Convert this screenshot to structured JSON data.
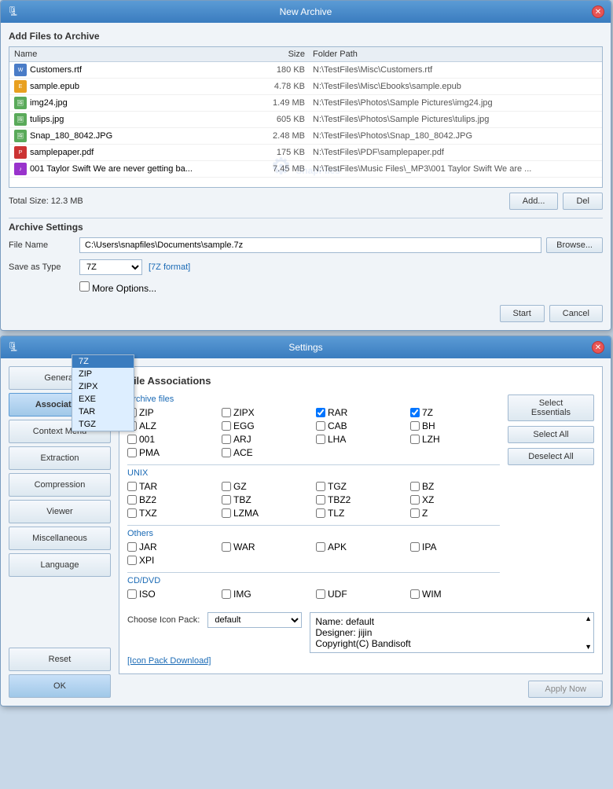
{
  "newArchive": {
    "title": "New Archive",
    "addFilesSection": "Add Files to Archive",
    "columns": {
      "name": "Name",
      "size": "Size",
      "folderPath": "Folder Path"
    },
    "files": [
      {
        "name": "Customers.rtf",
        "size": "180 KB",
        "path": "N:\\TestFiles\\Misc\\Customers.rtf",
        "type": "rtf"
      },
      {
        "name": "sample.epub",
        "size": "4.78 KB",
        "path": "N:\\TestFiles\\Misc\\Ebooks\\sample.epub",
        "type": "epub"
      },
      {
        "name": "img24.jpg",
        "size": "1.49 MB",
        "path": "N:\\TestFiles\\Photos\\Sample Pictures\\img24.jpg",
        "type": "img"
      },
      {
        "name": "tulips.jpg",
        "size": "605 KB",
        "path": "N:\\TestFiles\\Photos\\Sample Pictures\\tulips.jpg",
        "type": "img"
      },
      {
        "name": "Snap_180_8042.JPG",
        "size": "2.48 MB",
        "path": "N:\\TestFiles\\Photos\\Snap_180_8042.JPG",
        "type": "img"
      },
      {
        "name": "samplepaper.pdf",
        "size": "175 KB",
        "path": "N:\\TestFiles\\PDF\\samplepaper.pdf",
        "type": "pdf"
      },
      {
        "name": "001 Taylor Swift We are never getting ba...",
        "size": "7.45 MB",
        "path": "N:\\TestFiles\\Music Files\\_MP3\\001 Taylor Swift We are ...",
        "type": "mp3"
      }
    ],
    "watermark": "SnapFiles",
    "totalSize": "Total Size: 12.3 MB",
    "addButton": "Add...",
    "delButton": "Del",
    "archiveSettings": "Archive Settings",
    "fileName": "File Name",
    "fileNameValue": "C:\\Users\\snapfiles\\Documents\\sample.7z",
    "browseButton": "Browse...",
    "saveAsType": "Save as Type",
    "saveAsTypeValue": "7Z",
    "formatNote": "[7Z format]",
    "moreOptions": "More Options...",
    "startButton": "Start",
    "cancelButton": "Cancel",
    "dropdownOptions": [
      "ZIP",
      "ZIPX",
      "EXE",
      "TAR",
      "TGZ"
    ]
  },
  "settings": {
    "title": "Settings",
    "sidebar": [
      {
        "label": "General",
        "active": false
      },
      {
        "label": "Association",
        "active": true
      },
      {
        "label": "Context Menu",
        "active": false
      },
      {
        "label": "Extraction",
        "active": false
      },
      {
        "label": "Compression",
        "active": false
      },
      {
        "label": "Viewer",
        "active": false
      },
      {
        "label": "Miscellaneous",
        "active": false
      },
      {
        "label": "Language",
        "active": false
      }
    ],
    "resetButton": "Reset",
    "okButton": "OK",
    "contentTitle": "File Associations",
    "rightButtons": {
      "selectEssentials": "Select Essentials",
      "selectAll": "Select All",
      "deselectAll": "Deselect All"
    },
    "sections": {
      "archiveFiles": {
        "title": "Archive files",
        "items": [
          {
            "label": "ZIP",
            "checked": false
          },
          {
            "label": "ZIPX",
            "checked": false
          },
          {
            "label": "RAR",
            "checked": true
          },
          {
            "label": "7Z",
            "checked": true
          },
          {
            "label": "ALZ",
            "checked": false
          },
          {
            "label": "EGG",
            "checked": false
          },
          {
            "label": "CAB",
            "checked": false
          },
          {
            "label": "BH",
            "checked": false
          },
          {
            "label": "001",
            "checked": false
          },
          {
            "label": "ARJ",
            "checked": false
          },
          {
            "label": "LHA",
            "checked": false
          },
          {
            "label": "LZH",
            "checked": false
          },
          {
            "label": "PMA",
            "checked": false
          },
          {
            "label": "ACE",
            "checked": false
          }
        ]
      },
      "unix": {
        "title": "UNIX",
        "items": [
          {
            "label": "TAR",
            "checked": false
          },
          {
            "label": "GZ",
            "checked": false
          },
          {
            "label": "TGZ",
            "checked": false
          },
          {
            "label": "BZ",
            "checked": false
          },
          {
            "label": "BZ2",
            "checked": false
          },
          {
            "label": "TBZ",
            "checked": false
          },
          {
            "label": "TBZ2",
            "checked": false
          },
          {
            "label": "XZ",
            "checked": false
          },
          {
            "label": "TXZ",
            "checked": false
          },
          {
            "label": "LZMA",
            "checked": false
          },
          {
            "label": "TLZ",
            "checked": false
          },
          {
            "label": "Z",
            "checked": false
          }
        ]
      },
      "others": {
        "title": "Others",
        "items": [
          {
            "label": "JAR",
            "checked": false
          },
          {
            "label": "WAR",
            "checked": false
          },
          {
            "label": "APK",
            "checked": false
          },
          {
            "label": "IPA",
            "checked": false
          },
          {
            "label": "XPI",
            "checked": false
          }
        ]
      },
      "cdDvd": {
        "title": "CD/DVD",
        "items": [
          {
            "label": "ISO",
            "checked": false
          },
          {
            "label": "IMG",
            "checked": false
          },
          {
            "label": "UDF",
            "checked": false
          },
          {
            "label": "WIM",
            "checked": false
          }
        ]
      }
    },
    "iconPack": {
      "label": "Choose Icon Pack:",
      "value": "default",
      "infoName": "Name: default",
      "infoDesigner": "Designer: jijin",
      "infoCopyright": "Copyright(C) Bandisoft",
      "downloadLink": "[Icon Pack Download]"
    },
    "applyNow": "Apply Now"
  }
}
